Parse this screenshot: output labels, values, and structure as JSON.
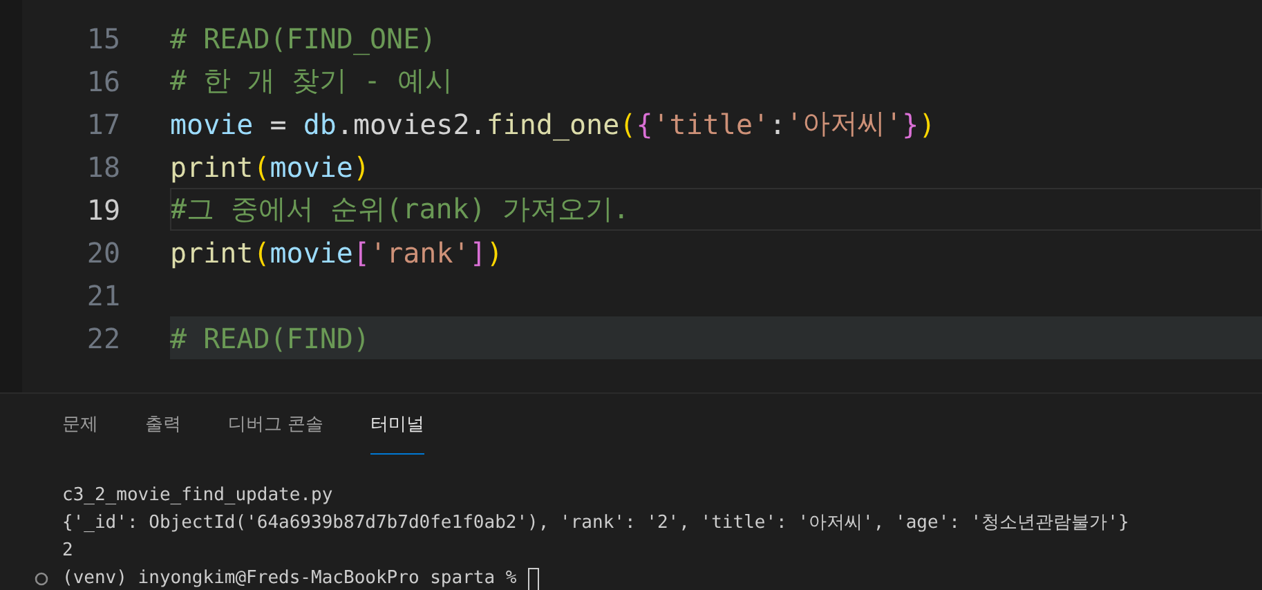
{
  "editor": {
    "lines": [
      {
        "number": "15",
        "current": false,
        "highlighted": false,
        "tokens": [
          {
            "text": "# READ(FIND_ONE)",
            "kind": "comment"
          }
        ]
      },
      {
        "number": "16",
        "current": false,
        "highlighted": false,
        "tokens": [
          {
            "text": "# 한 개 찾기 - 예시",
            "kind": "comment"
          }
        ]
      },
      {
        "number": "17",
        "current": false,
        "highlighted": false,
        "tokens": [
          {
            "text": "movie",
            "kind": "variable"
          },
          {
            "text": " = ",
            "kind": "plain"
          },
          {
            "text": "db",
            "kind": "variable"
          },
          {
            "text": ".movies2.",
            "kind": "plain"
          },
          {
            "text": "find_one",
            "kind": "function"
          },
          {
            "text": "(",
            "kind": "bracket1"
          },
          {
            "text": "{",
            "kind": "bracket2"
          },
          {
            "text": "'title'",
            "kind": "string"
          },
          {
            "text": ":",
            "kind": "plain"
          },
          {
            "text": "'아저씨'",
            "kind": "string"
          },
          {
            "text": "}",
            "kind": "bracket2"
          },
          {
            "text": ")",
            "kind": "bracket1"
          }
        ]
      },
      {
        "number": "18",
        "current": false,
        "highlighted": false,
        "tokens": [
          {
            "text": "print",
            "kind": "function"
          },
          {
            "text": "(",
            "kind": "bracket1"
          },
          {
            "text": "movie",
            "kind": "variable"
          },
          {
            "text": ")",
            "kind": "bracket1"
          }
        ]
      },
      {
        "number": "19",
        "current": true,
        "highlighted": false,
        "tokens": [
          {
            "text": "#그 중에서 순위(rank) 가져오기.",
            "kind": "comment"
          }
        ]
      },
      {
        "number": "20",
        "current": false,
        "highlighted": false,
        "tokens": [
          {
            "text": "print",
            "kind": "function"
          },
          {
            "text": "(",
            "kind": "bracket1"
          },
          {
            "text": "movie",
            "kind": "variable"
          },
          {
            "text": "[",
            "kind": "bracket2"
          },
          {
            "text": "'rank'",
            "kind": "string"
          },
          {
            "text": "]",
            "kind": "bracket2"
          },
          {
            "text": ")",
            "kind": "bracket1"
          }
        ]
      },
      {
        "number": "21",
        "current": false,
        "highlighted": false
      },
      {
        "number": "22",
        "current": false,
        "highlighted": true,
        "tokens": [
          {
            "text": "# READ(FIND)",
            "kind": "comment"
          }
        ]
      }
    ]
  },
  "panel": {
    "tabs": [
      {
        "label": "문제",
        "selected": false
      },
      {
        "label": "출력",
        "selected": false
      },
      {
        "label": "디버그 콘솔",
        "selected": false
      },
      {
        "label": "터미널",
        "selected": true
      }
    ],
    "terminal": {
      "lines": [
        "c3_2_movie_find_update.py",
        "{'_id': ObjectId('64a6939b87d7b7d0fe1f0ab2'), 'rank': '2', 'title': '아저씨', 'age': '청소년관람불가'}",
        "2"
      ],
      "prompt": "(venv) inyongkim@Freds-MacBookPro sparta %"
    }
  }
}
